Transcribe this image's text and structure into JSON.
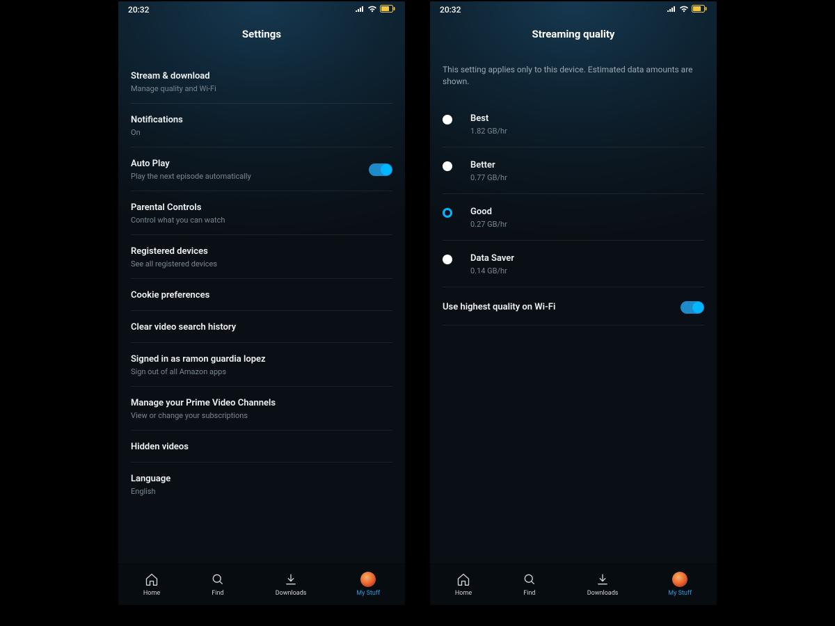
{
  "status": {
    "time": "20:32"
  },
  "left": {
    "header": "Settings",
    "rows": [
      {
        "title": "Stream & download",
        "sub": "Manage quality and Wi-Fi"
      },
      {
        "title": "Notifications",
        "sub": "On"
      },
      {
        "title": "Auto Play",
        "sub": "Play the next episode automatically"
      },
      {
        "title": "Parental Controls",
        "sub": "Control what you can watch"
      },
      {
        "title": "Registered devices",
        "sub": "See all registered devices"
      },
      {
        "title": "Cookie preferences",
        "sub": ""
      },
      {
        "title": "Clear video search history",
        "sub": ""
      },
      {
        "title": "Signed in as ramon guardia lopez",
        "sub": "Sign out of all Amazon apps"
      },
      {
        "title": "Manage your Prime Video Channels",
        "sub": "View or change your subscriptions"
      },
      {
        "title": "Hidden videos",
        "sub": ""
      },
      {
        "title": "Language",
        "sub": "English"
      }
    ]
  },
  "right": {
    "header": "Streaming quality",
    "description": "This setting applies only to this device. Estimated data amounts are shown.",
    "options": [
      {
        "title": "Best",
        "sub": "1.82 GB/hr"
      },
      {
        "title": "Better",
        "sub": "0.77 GB/hr"
      },
      {
        "title": "Good",
        "sub": "0.27 GB/hr"
      },
      {
        "title": "Data Saver",
        "sub": "0.14 GB/hr"
      }
    ],
    "wifi_label": "Use highest quality on Wi-Fi"
  },
  "nav": {
    "items": [
      "Home",
      "Find",
      "Downloads",
      "My Stuff"
    ]
  }
}
